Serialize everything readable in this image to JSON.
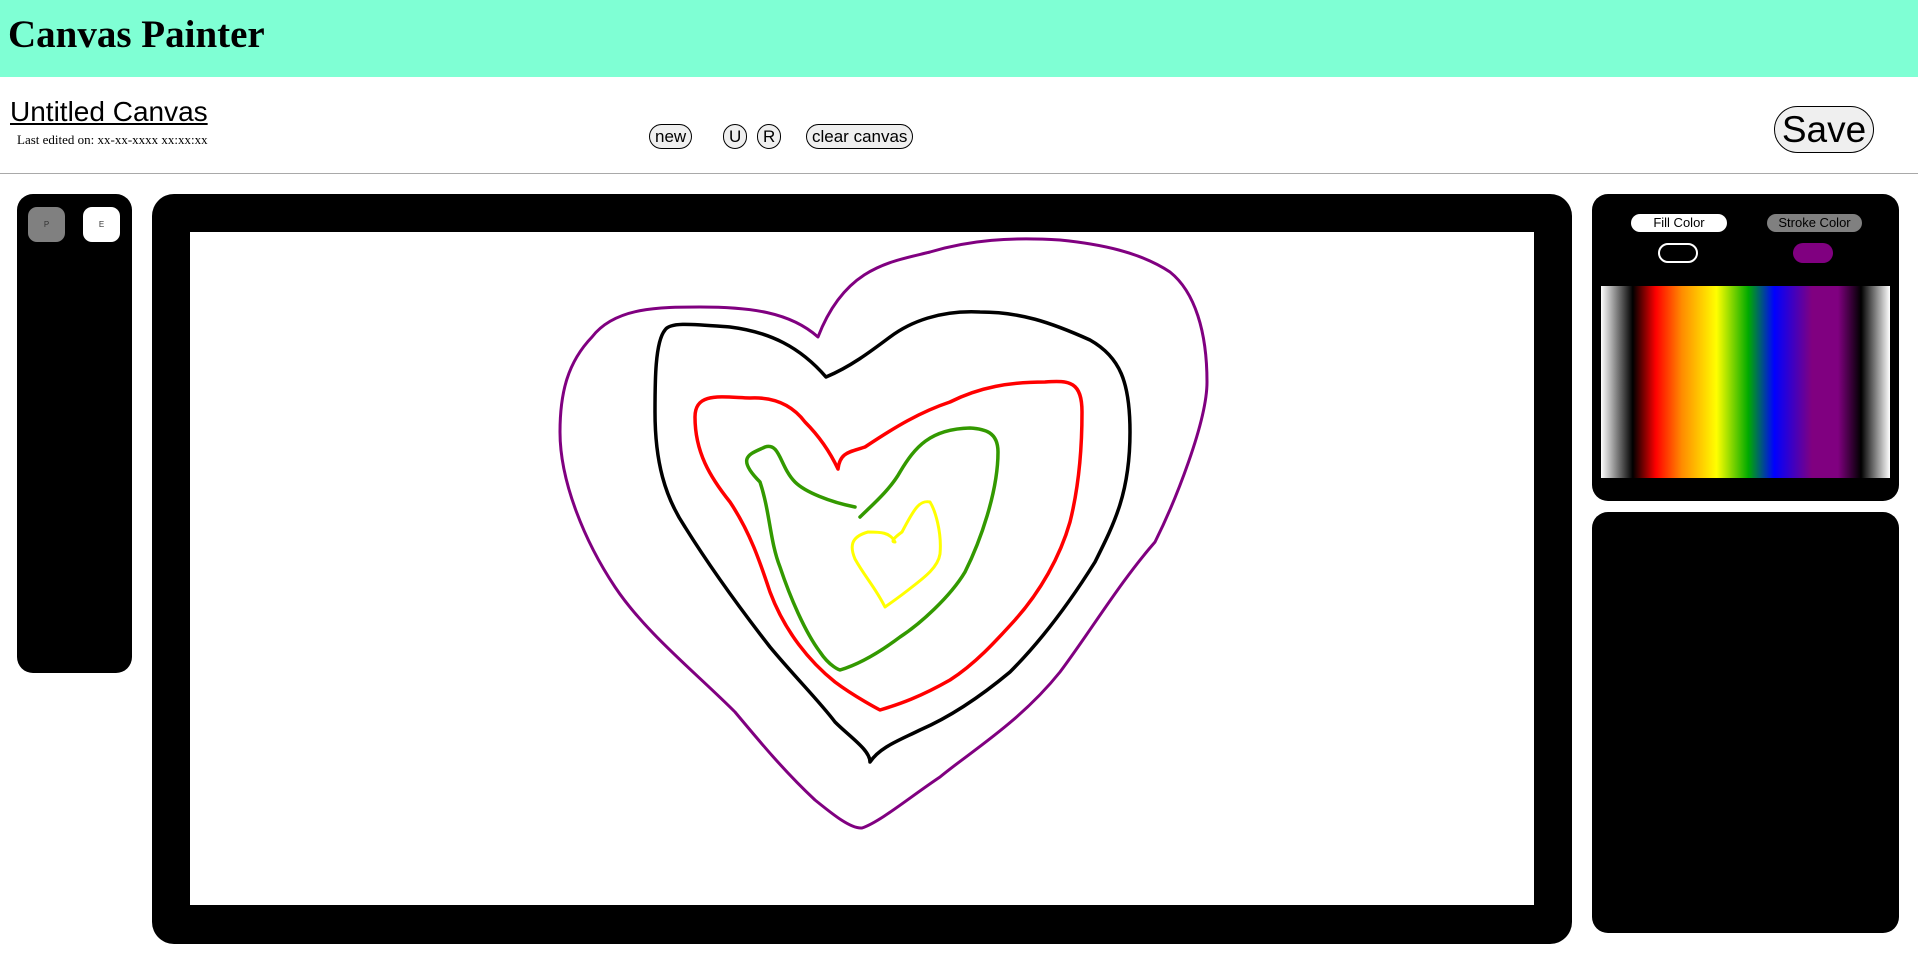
{
  "header": {
    "app_title": "Canvas Painter"
  },
  "document": {
    "title": "Untitled Canvas",
    "last_edited": "Last edited on: xx-xx-xxxx xx:xx:xx"
  },
  "toolbar": {
    "new_label": "new",
    "undo_label": "U",
    "redo_label": "R",
    "clear_label": "clear canvas",
    "save_label": "Save"
  },
  "tools": {
    "pen_label": "P",
    "eraser_label": "E",
    "active": "pen"
  },
  "colors": {
    "fill_label": "Fill Color",
    "stroke_label": "Stroke Color",
    "fill_value": "#000000",
    "stroke_value": "#800080",
    "active": "stroke"
  },
  "drawing": {
    "stroke_colors": [
      "#800080",
      "#000000",
      "#ff0000",
      "#339900",
      "#ffff00"
    ]
  }
}
